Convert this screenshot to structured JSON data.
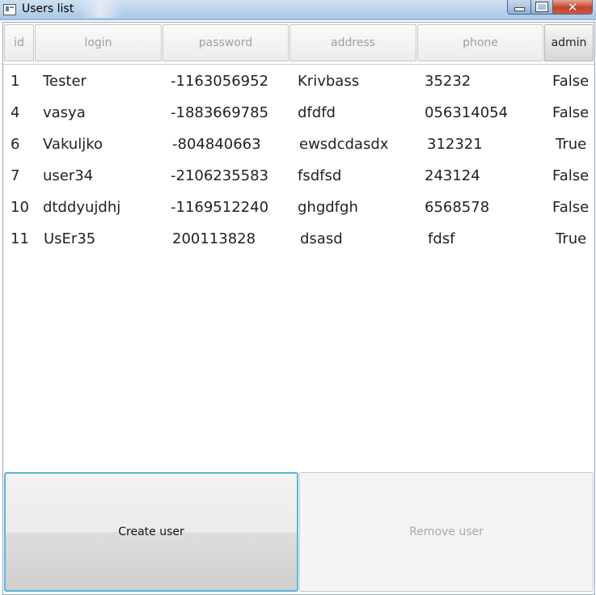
{
  "window": {
    "title": "Users list",
    "icon": "app-window-icon",
    "controls": {
      "minimize": "minimize-icon",
      "maximize": "maximize-icon",
      "close": "✕"
    }
  },
  "table": {
    "columns": [
      {
        "key": "id",
        "label": "id"
      },
      {
        "key": "login",
        "label": "login"
      },
      {
        "key": "password",
        "label": "password"
      },
      {
        "key": "address",
        "label": "address"
      },
      {
        "key": "phone",
        "label": "phone"
      },
      {
        "key": "admin",
        "label": "admin"
      }
    ],
    "rows": [
      {
        "id": "1",
        "login": "Tester",
        "password": "-1163056952",
        "address": "Krivbass",
        "phone": "35232",
        "admin": "False"
      },
      {
        "id": "4",
        "login": "vasya",
        "password": "-1883669785",
        "address": "dfdfd",
        "phone": "056314054",
        "admin": "False"
      },
      {
        "id": "6",
        "login": "Vakuljko",
        "password": "-804840663",
        "address": "ewsdcdasdx",
        "phone": "312321",
        "admin": "True"
      },
      {
        "id": "7",
        "login": "user34",
        "password": "-2106235583",
        "address": "fsdfsd",
        "phone": "243124",
        "admin": "False"
      },
      {
        "id": "10",
        "login": "dtddyujdhj",
        "password": "-1169512240",
        "address": "ghgdfgh",
        "phone": "6568578",
        "admin": "False"
      },
      {
        "id": "11",
        "login": "UsEr35",
        "password": "200113828",
        "address": "dsasd",
        "phone": "fdsf",
        "admin": "True"
      }
    ]
  },
  "buttons": {
    "create_label": "Create user",
    "remove_label": "Remove user"
  },
  "colors": {
    "focus_border": "#5bb5d8",
    "disabled_text": "#a7a7a7",
    "close_button": "#c4432b"
  }
}
